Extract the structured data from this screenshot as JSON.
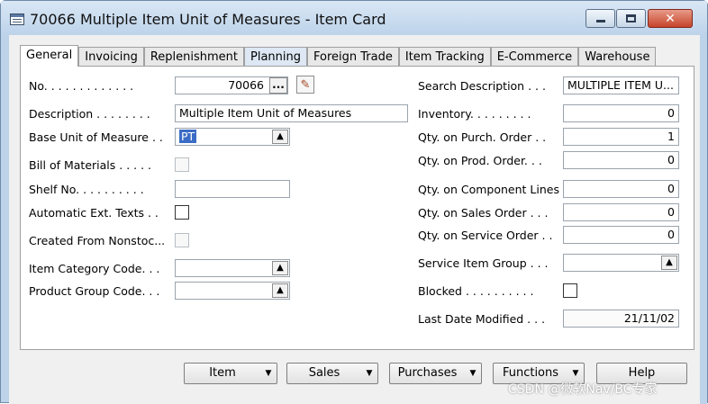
{
  "window": {
    "title": "70066 Multiple Item Unit of Measures - Item Card"
  },
  "tabs": [
    "General",
    "Invoicing",
    "Replenishment",
    "Planning",
    "Foreign Trade",
    "Item Tracking",
    "E-Commerce",
    "Warehouse"
  ],
  "left_fields": {
    "no_label": "No. . . . . . . . . . . . .",
    "no_value": "70066",
    "no_assist": "...",
    "description_label": "Description . . . . . . . .",
    "description_value": "Multiple Item Unit of Measures",
    "base_uom_label": "Base Unit of Measure . .",
    "base_uom_value": "PT",
    "bom_label": "Bill of Materials . . . . .",
    "shelf_label": "Shelf No. . . . . . . . . .",
    "shelf_value": "",
    "auto_ext_label": "Automatic Ext. Texts . .",
    "created_label": "Created From Nonstoc...",
    "item_cat_label": "Item Category Code. . .",
    "item_cat_value": "",
    "prod_group_label": "Product Group Code. . .",
    "prod_group_value": ""
  },
  "right_fields": {
    "search_desc_label": "Search Description . . .",
    "search_desc_value": "MULTIPLE ITEM U...",
    "inventory_label": "Inventory. . . . . . . . .",
    "inventory_value": "0",
    "purch_label": "Qty. on Purch. Order . .",
    "purch_value": "1",
    "prod_label": "Qty. on Prod. Order. . .",
    "prod_value": "0",
    "comp_label": "Qty. on Component Lines",
    "comp_value": "0",
    "sales_label": "Qty. on Sales Order . . .",
    "sales_value": "0",
    "service_order_label": "Qty. on Service Order . .",
    "service_order_value": "0",
    "service_group_label": "Service Item Group . . .",
    "service_group_value": "",
    "blocked_label": "Blocked . . . . . . . . . .",
    "last_modified_label": "Last Date Modified . . .",
    "last_modified_value": "21/11/02"
  },
  "buttons": {
    "item": "Item",
    "sales": "Sales",
    "purchases": "Purchases",
    "functions": "Functions",
    "help": "Help"
  },
  "watermark": "CSDN @微软Nav/BC专家",
  "icons": {
    "window": "item-card-icon",
    "lookup": "up-arrow-icon",
    "edit": "pencil-icon",
    "dropdown": "chevron-down-icon"
  },
  "colors": {
    "titlebar": "#bcd3ea",
    "close_button": "#c7432a",
    "selection": "#3b6cc6"
  }
}
